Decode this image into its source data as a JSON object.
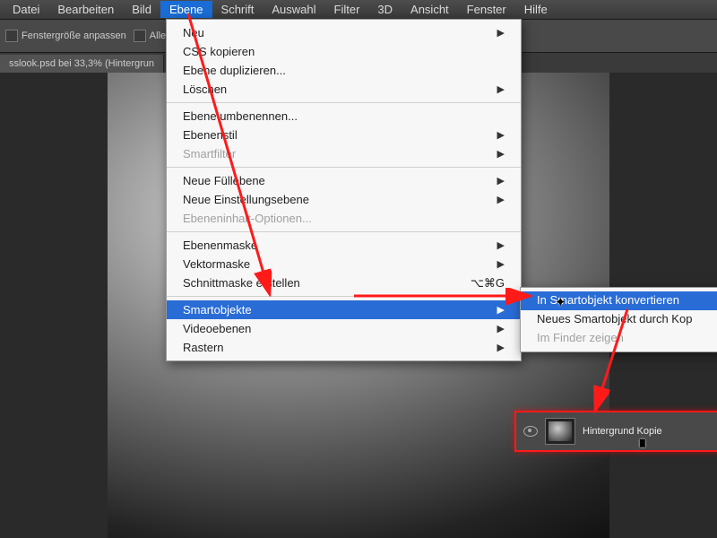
{
  "menubar": {
    "items": [
      "Datei",
      "Bearbeiten",
      "Bild",
      "Ebene",
      "Schrift",
      "Auswahl",
      "Filter",
      "3D",
      "Ansicht",
      "Fenster",
      "Hilfe"
    ],
    "active_index": 3
  },
  "toolbar": {
    "option_a": "Fenstergröße anpassen",
    "option_b": "Alle Fenster"
  },
  "tab": {
    "title": "sslook.psd bei 33,3% (Hintergrun"
  },
  "dropdown": {
    "items": [
      {
        "label": "Neu",
        "arrow": true,
        "disabled": false
      },
      {
        "label": "CSS kopieren",
        "disabled": false
      },
      {
        "label": "Ebene duplizieren...",
        "disabled": false
      },
      {
        "label": "Löschen",
        "arrow": true,
        "disabled": false
      },
      {
        "sep": true
      },
      {
        "label": "Ebene umbenennen...",
        "disabled": false
      },
      {
        "label": "Ebenenstil",
        "arrow": true,
        "disabled": false
      },
      {
        "label": "Smartfilter",
        "arrow": true,
        "disabled": true
      },
      {
        "sep": true
      },
      {
        "label": "Neue Füllebene",
        "arrow": true,
        "disabled": false
      },
      {
        "label": "Neue Einstellungsebene",
        "arrow": true,
        "disabled": false
      },
      {
        "label": "Ebeneninhalt-Optionen...",
        "disabled": true
      },
      {
        "sep": true
      },
      {
        "label": "Ebenenmaske",
        "arrow": true,
        "disabled": false
      },
      {
        "label": "Vektormaske",
        "arrow": true,
        "disabled": false
      },
      {
        "label": "Schnittmaske erstellen",
        "shortcut": "⌥⌘G",
        "disabled": false
      },
      {
        "sep": true
      },
      {
        "label": "Smartobjekte",
        "arrow": true,
        "hl": true
      },
      {
        "label": "Videoebenen",
        "arrow": true,
        "disabled": false
      },
      {
        "label": "Rastern",
        "arrow": true,
        "disabled": false
      }
    ]
  },
  "submenu": {
    "items": [
      {
        "label": "In Smartobjekt konvertieren",
        "hl": true
      },
      {
        "label": "Neues Smartobjekt durch Kop"
      },
      {
        "sep": true
      },
      {
        "label": "Im Finder zeigen",
        "disabled": true
      }
    ]
  },
  "layer": {
    "name": "Hintergrund Kopie"
  },
  "annotation_color": "#ff1a1a"
}
